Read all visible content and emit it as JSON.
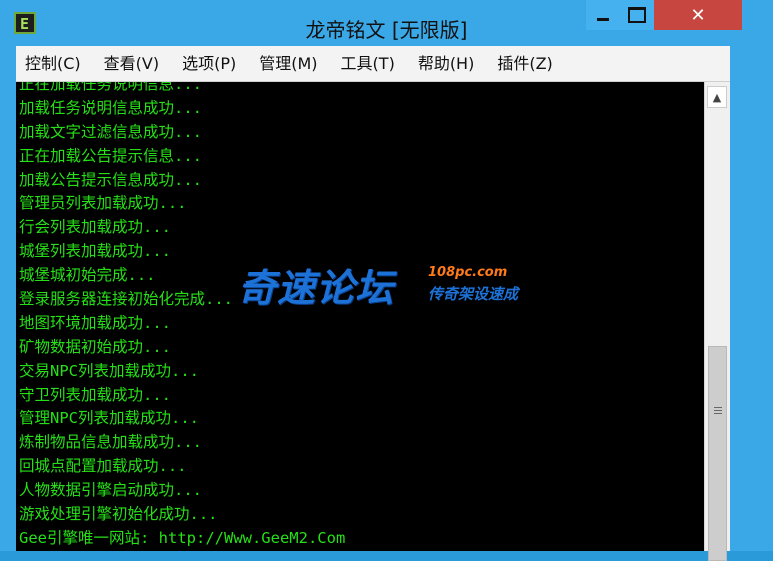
{
  "window": {
    "title": "龙帝铭文 [无限版]",
    "app_icon_letter": "E",
    "controls": {
      "minimize": "minimize-icon",
      "maximize": "maximize-icon",
      "close": "✕"
    }
  },
  "menu": [
    "控制(C)",
    "查看(V)",
    "选项(P)",
    "管理(M)",
    "工具(T)",
    "帮助(H)",
    "插件(Z)"
  ],
  "console": {
    "text_color": "#26e017",
    "background": "#000000",
    "lines": [
      "正在加载任务说明信息...",
      "加载任务说明信息成功...",
      "加载文字过滤信息成功...",
      "正在加载公告提示信息...",
      "加载公告提示信息成功...",
      "管理员列表加载成功...",
      "行会列表加载成功...",
      "城堡列表加载成功...",
      "城堡城初始完成...",
      "登录服务器连接初始化完成...",
      "地图环境加载成功...",
      "矿物数据初始成功...",
      "交易NPC列表加载成功...",
      "守卫列表加载成功...",
      "管理NPC列表加载成功...",
      "炼制物品信息加载成功...",
      "回城点配置加载成功...",
      "人物数据引擎启动成功...",
      "游戏处理引擎初始化成功...",
      "Gee引擎唯一网站: http://Www.GeeM2.Com"
    ]
  },
  "watermark": {
    "main": "奇速论坛",
    "site": "108pc.com",
    "slogan": "传奇架设速成"
  },
  "scrollbar": {
    "up_arrow": "▲",
    "position": 0.62
  }
}
